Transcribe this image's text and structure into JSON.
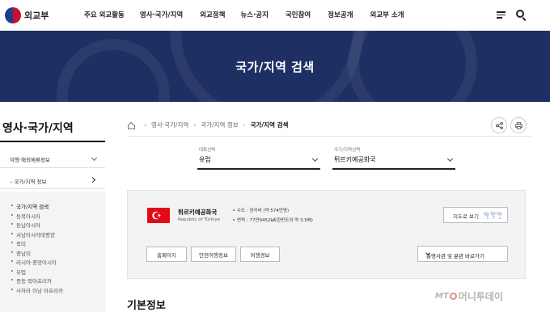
{
  "header": {
    "logo_text": "외교부",
    "nav": [
      "주요 외교활동",
      "영사·국가/지역",
      "외교정책",
      "뉴스·공지",
      "국민참여",
      "정보공개",
      "외교부 소개"
    ],
    "menu_icon": "hamburger-icon",
    "search_icon": "search-icon"
  },
  "banner": {
    "title": "국가/지역 검색"
  },
  "sidebar": {
    "title": "영사·국가/지역",
    "item1": "여행·해외체류정보",
    "item2": "국가/지역 정보",
    "submenu": [
      "국가/지역 검색",
      "동북아시아",
      "동남아시아",
      "서남아시아태평양",
      "북미",
      "중남미",
      "러시아·중앙아시아",
      "유럽",
      "중동·북아프리카",
      "사하라 이남 아프리카"
    ]
  },
  "breadcrumb": {
    "items": [
      "영사·국가/지역",
      "국가/지역 정보",
      "국가/지역 검색"
    ],
    "home_icon": "home-icon",
    "share_icon": "share-icon",
    "print_icon": "print-icon"
  },
  "selectors": {
    "region": {
      "label": "대륙선택",
      "value": "유럽"
    },
    "country": {
      "label": "국가/지역선택",
      "value": "튀르키예공화국"
    }
  },
  "country_card": {
    "name": "튀르키예공화국",
    "name_en": "Republic of Türkiye",
    "capital": "수도 : 앙카라 (약 574만명)",
    "area": "면적 : 77만9452㎢(한반도의 약 3.5배)",
    "map_button": "지도로 보기",
    "links": [
      "홈페이지",
      "안전여행정보",
      "여행경보"
    ],
    "embassy_select": "총영사관 및 분관 바로가기",
    "flag_colors": {
      "red": "#e30a17",
      "white": "#ffffff"
    }
  },
  "section": {
    "title": "기본정보"
  },
  "watermark": {
    "brand_a": "MT",
    "brand_b": "머니투데이"
  },
  "colors": {
    "banner": "#1d2f63"
  }
}
